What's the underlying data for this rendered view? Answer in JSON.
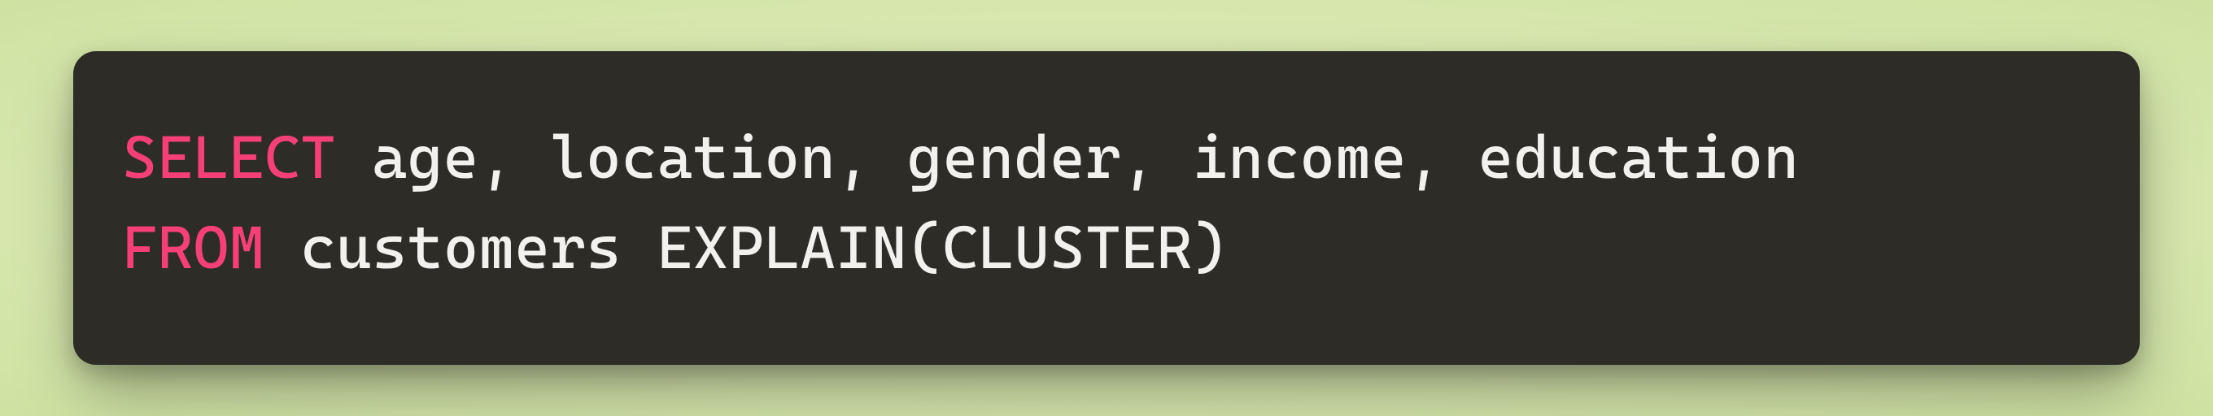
{
  "code": {
    "line1": {
      "kw": "SELECT",
      "rest": " age, location, gender, income, education"
    },
    "line2": {
      "kw": "FROM",
      "rest": " customers EXPLAIN(CLUSTER)"
    }
  }
}
